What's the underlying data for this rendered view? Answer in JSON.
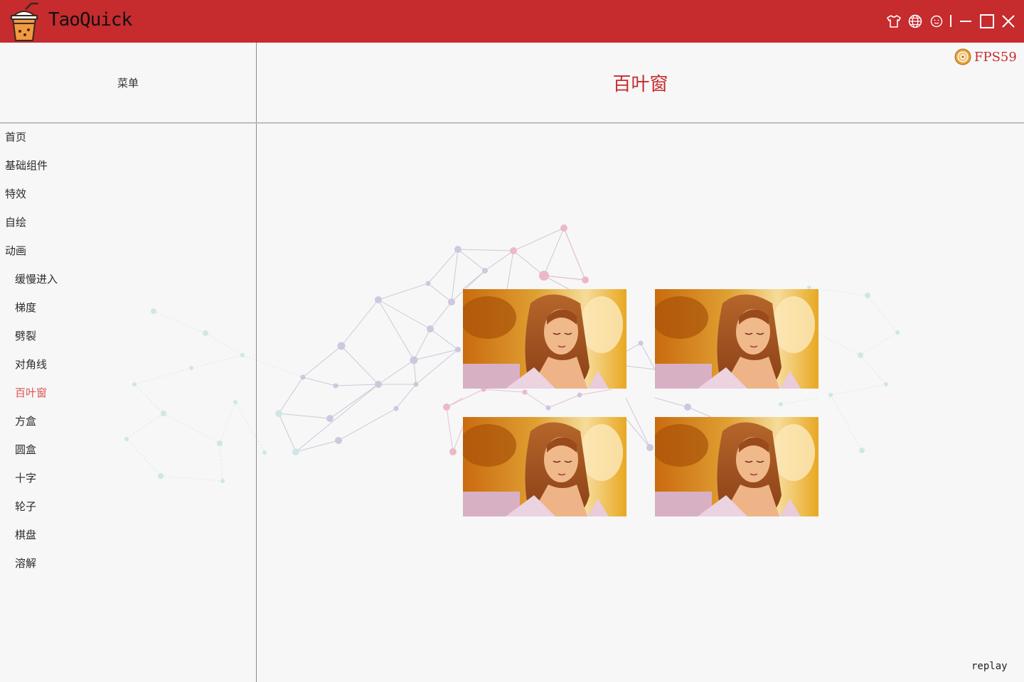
{
  "app": {
    "title": "TaoQuick",
    "accent": "#c62b2e"
  },
  "titlebar": {
    "buttons": [
      {
        "name": "skin-icon"
      },
      {
        "name": "language-icon"
      },
      {
        "name": "smiley-icon"
      },
      {
        "name": "minimize-icon"
      },
      {
        "name": "maximize-icon"
      },
      {
        "name": "close-icon"
      }
    ]
  },
  "sidebar": {
    "header": "菜单",
    "items": [
      {
        "label": "首页",
        "level": 0,
        "active": false
      },
      {
        "label": "基础组件",
        "level": 0,
        "active": false
      },
      {
        "label": "特效",
        "level": 0,
        "active": false
      },
      {
        "label": "自绘",
        "level": 0,
        "active": false
      },
      {
        "label": "动画",
        "level": 0,
        "active": false
      },
      {
        "label": "缓慢进入",
        "level": 1,
        "active": false
      },
      {
        "label": "梯度",
        "level": 1,
        "active": false
      },
      {
        "label": "劈裂",
        "level": 1,
        "active": false
      },
      {
        "label": "对角线",
        "level": 1,
        "active": false
      },
      {
        "label": "百叶窗",
        "level": 1,
        "active": true
      },
      {
        "label": "方盒",
        "level": 1,
        "active": false
      },
      {
        "label": "圆盒",
        "level": 1,
        "active": false
      },
      {
        "label": "十字",
        "level": 1,
        "active": false
      },
      {
        "label": "轮子",
        "level": 1,
        "active": false
      },
      {
        "label": "棋盘",
        "level": 1,
        "active": false
      },
      {
        "label": "溶解",
        "level": 1,
        "active": false
      }
    ]
  },
  "main": {
    "title": "百叶窗",
    "fps": "FPS59",
    "replay": "replay",
    "tiles": [
      {
        "name": "blinds-preview-1"
      },
      {
        "name": "blinds-preview-2"
      },
      {
        "name": "blinds-preview-3"
      },
      {
        "name": "blinds-preview-4"
      }
    ]
  }
}
